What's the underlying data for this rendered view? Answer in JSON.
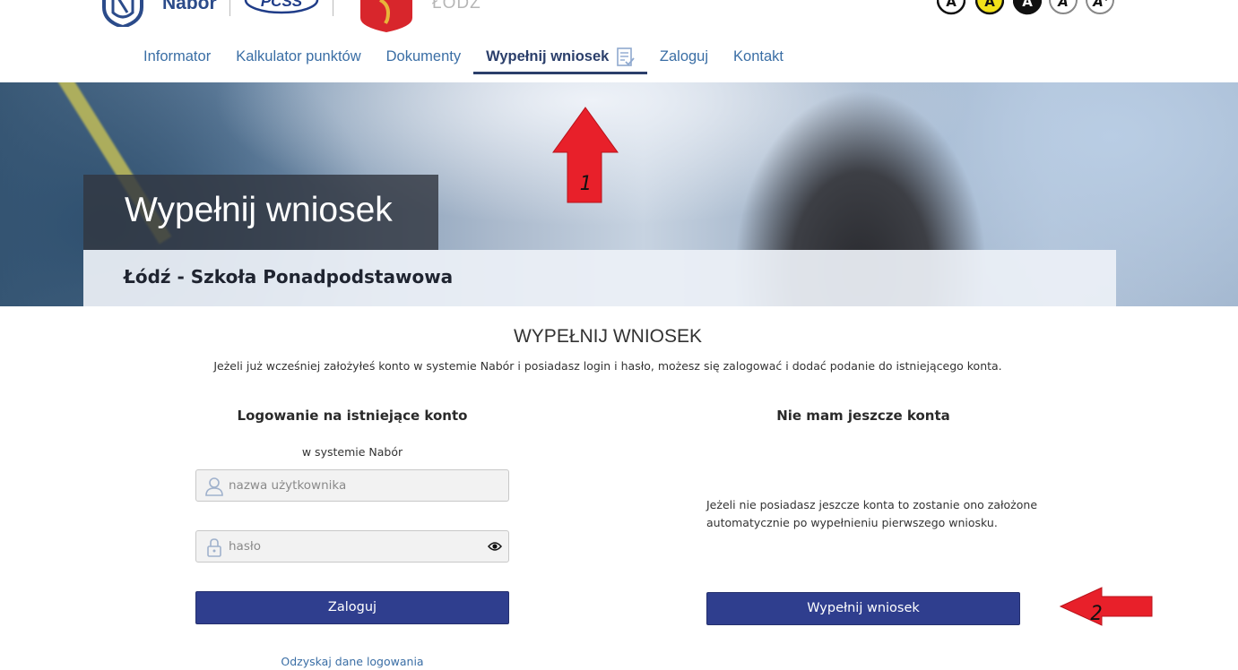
{
  "header": {
    "brand": "Nabór",
    "city": "ŁÓDŹ",
    "a11y_buttons": [
      {
        "label": "A",
        "style": "default"
      },
      {
        "label": "A",
        "style": "yellow"
      },
      {
        "label": "A",
        "style": "black"
      },
      {
        "label": "A",
        "style": "italic"
      },
      {
        "label": "A+",
        "style": "larger"
      }
    ]
  },
  "nav": {
    "items": [
      {
        "label": "Informator"
      },
      {
        "label": "Kalkulator punktów"
      },
      {
        "label": "Dokumenty"
      },
      {
        "label": "Wypełnij wniosek",
        "active": true
      },
      {
        "label": "Zaloguj"
      },
      {
        "label": "Kontakt"
      }
    ]
  },
  "hero": {
    "title": "Wypełnij wniosek",
    "subtitle": "Łódź - Szkoła Ponadpodstawowa"
  },
  "annotations": {
    "arrow1_label": "1",
    "arrow2_label": "2",
    "arrow_color": "#e8202a"
  },
  "main": {
    "title": "WYPEŁNIJ WNIOSEK",
    "description": "Jeżeli już wcześniej założyłeś konto w systemie Nabór i posiadasz login i hasło, możesz się zalogować i dodać podanie do istniejącego konta.",
    "login": {
      "title": "Logowanie na istniejące konto",
      "subtitle": "w systemie Nabór",
      "username_placeholder": "nazwa użytkownika",
      "password_placeholder": "hasło",
      "button": "Zaloguj",
      "recover_link": "Odzyskaj dane logowania"
    },
    "no_account": {
      "title": "Nie mam jeszcze konta",
      "description": "Jeżeli nie posiadasz jeszcze konta to zostanie ono założone automatycznie po wypełnieniu pierwszego wniosku.",
      "button": "Wypełnij wniosek"
    }
  },
  "colors": {
    "primary_button": "#2f3e8e",
    "nav_link": "#3a6ea5",
    "nav_active": "#2b3f6b"
  }
}
